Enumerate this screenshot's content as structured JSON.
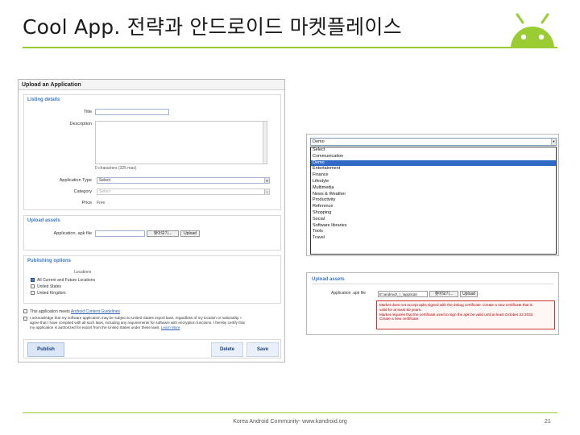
{
  "slide": {
    "title": "Cool App. 전략과 안드로이드 마켓플레이스",
    "footer_text": "Korea Android Community- www.kandroid.org",
    "page_number": "21",
    "accent_color": "#9acd32",
    "logo_icon": "android-robot-icon"
  },
  "upload_form": {
    "header": "Upload an Application",
    "listing": {
      "title": "Listing details",
      "title_label": "Title",
      "description_label": "Description",
      "char_count": "0 characters (325 max)",
      "app_type_label": "Application Type",
      "app_type_value": "Select",
      "category_label": "Category",
      "category_value": "Select",
      "price_label": "Price",
      "price_value": "Free"
    },
    "assets": {
      "title": "Upload assets",
      "apk_label": "Application .apk file",
      "browse_label": "찾아보기...",
      "upload_label": "Upload"
    },
    "publishing": {
      "title": "Publishing options",
      "locations_label": "Locations",
      "locations": [
        {
          "label": "All Current and Future Locations",
          "checked": true
        },
        {
          "label": "United States",
          "checked": false
        },
        {
          "label": "United Kingdom",
          "checked": false
        }
      ]
    },
    "agreements": {
      "guidelines_prefix": "This application meets",
      "guidelines_link": "Android Content Guidelines",
      "export_text_1": "I acknowledge that my software application may be subject to United States export laws, regardless of my location or nationality. I",
      "export_text_2": "agree that I have complied with all such laws, including any requirements for software with encryption functions. I hereby certify that",
      "export_text_3": "my application is authorized for export from the United States under these laws.",
      "learn_more": "Learn More"
    },
    "actions": {
      "publish": "Publish",
      "delete": "Delete",
      "save": "Save"
    }
  },
  "category_dropdown": {
    "selected": "Demo",
    "items": [
      "Select",
      "Communication",
      "Demo",
      "Entertainment",
      "Finance",
      "Lifestyle",
      "Multimedia",
      "News & Weather",
      "Productivity",
      "Reference",
      "Shopping",
      "Social",
      "Software libraries",
      "Tools",
      "Travel"
    ],
    "highlighted_index": 2
  },
  "upload_error": {
    "title": "Upload assets",
    "apk_label": "Application .apk file",
    "file_value": "E:\\android\\_\\_\\applicati",
    "browse_label": "찾아보기...",
    "upload_label": "Upload",
    "errors": [
      "Market does not accept apks signed with the debug certificate. Create a new certificate that is",
      "valid for at least 50 years.",
      "Market requires that the certificate used to sign the apk be valid until at least October 22 2033.",
      "Create a new certificate."
    ]
  }
}
